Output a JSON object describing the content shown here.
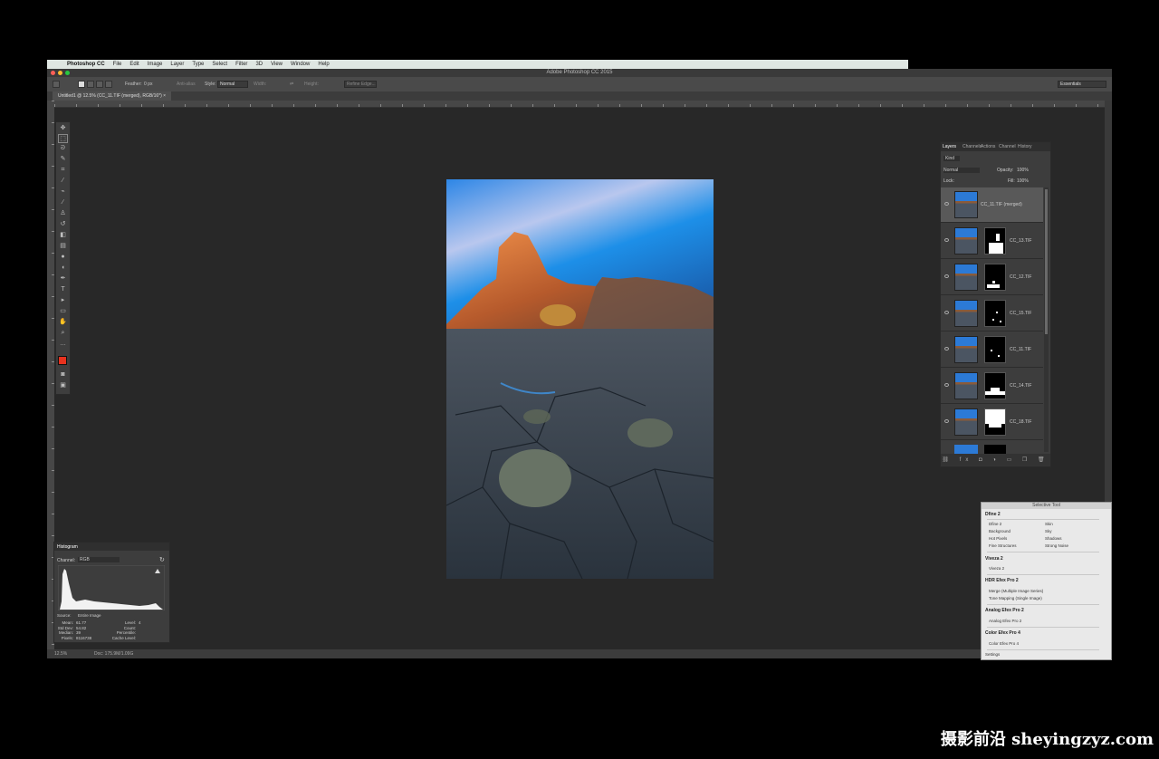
{
  "menubar": {
    "app": "Photoshop CC",
    "items": [
      "File",
      "Edit",
      "Image",
      "Layer",
      "Type",
      "Select",
      "Filter",
      "3D",
      "View",
      "Window",
      "Help"
    ]
  },
  "window": {
    "title": "Adobe Photoshop CC 2015",
    "doc_tab": "Untitled1 @ 12.5% (CC_11.TIF (merged), RGB/16*) ×"
  },
  "options": {
    "feather_label": "Feather:",
    "feather_value": "0 px",
    "antialias": "Anti-alias",
    "style_label": "Style:",
    "style_value": "Normal",
    "width_label": "Width:",
    "height_label": "Height:",
    "refine_edge": "Refine Edge...",
    "workspace": "Essentials"
  },
  "status": {
    "zoom": "12.5%",
    "doc": "Doc: 175.9M/1.09G"
  },
  "layers_panel": {
    "tabs": [
      "Layers",
      "Channels",
      "Actions",
      "Channel",
      "History"
    ],
    "kind": "Kind",
    "blend": "Normal",
    "opacity_label": "Opacity:",
    "opacity": "100%",
    "lock_label": "Lock:",
    "fill_label": "Fill:",
    "fill": "100%",
    "layers": [
      {
        "name": "CC_11.TIF (merged)",
        "mask": false
      },
      {
        "name": "CC_13.TIF",
        "mask": true
      },
      {
        "name": "CC_12.TIF",
        "mask": true
      },
      {
        "name": "CC_15.TIF",
        "mask": true
      },
      {
        "name": "CC_11.TIF",
        "mask": true
      },
      {
        "name": "CC_14.TIF",
        "mask": true
      },
      {
        "name": "CC_18.TIF",
        "mask": true
      }
    ]
  },
  "histogram": {
    "title": "Histogram",
    "channel_label": "Channel:",
    "channel": "RGB",
    "source_label": "Source:",
    "source": "Entire Image",
    "stats_left": [
      "Mean:",
      "Std Dev:",
      "Median:",
      "Pixels:"
    ],
    "stats_left_vals": [
      "61.77",
      "54.82",
      "39",
      "8116738"
    ],
    "stats_right": [
      "Level:",
      "Count:",
      "Percentile:",
      "Cache Level:"
    ],
    "stats_right_vals": [
      "",
      "",
      "",
      "4"
    ]
  },
  "selective": {
    "title": "Selective Tool",
    "sections": [
      "Dfine 2",
      "Viveza 2",
      "HDR Efex Pro 2",
      "Analog Efex Pro 2",
      "Color Efex Pro 4"
    ],
    "dfine_cells": [
      "Dfine 2",
      "Skin",
      "Background",
      "Sky",
      "Hot Pixels",
      "Shadows",
      "Fine Structures",
      "Strong Noise"
    ],
    "viveza_cell": "Viveza 2",
    "hdr_cells": [
      "Merge (Multiple Image Series)",
      "Tone Mapping (Single Image)"
    ],
    "analog_cell": "Analog Efex Pro 2",
    "color_cell": "Color Efex Pro 4",
    "settings": "Settings"
  },
  "watermark": "摄影前沿 sheyingzyz.com",
  "colors": {
    "foreground": "#e8321e",
    "background": "#ffffff",
    "accent": "#2c7ad6"
  },
  "icons": [
    "apple-icon",
    "move-icon",
    "marquee-icon",
    "lasso-icon",
    "crop-icon",
    "eyedropper-icon",
    "brush-icon",
    "eye-icon",
    "refresh-icon"
  ]
}
